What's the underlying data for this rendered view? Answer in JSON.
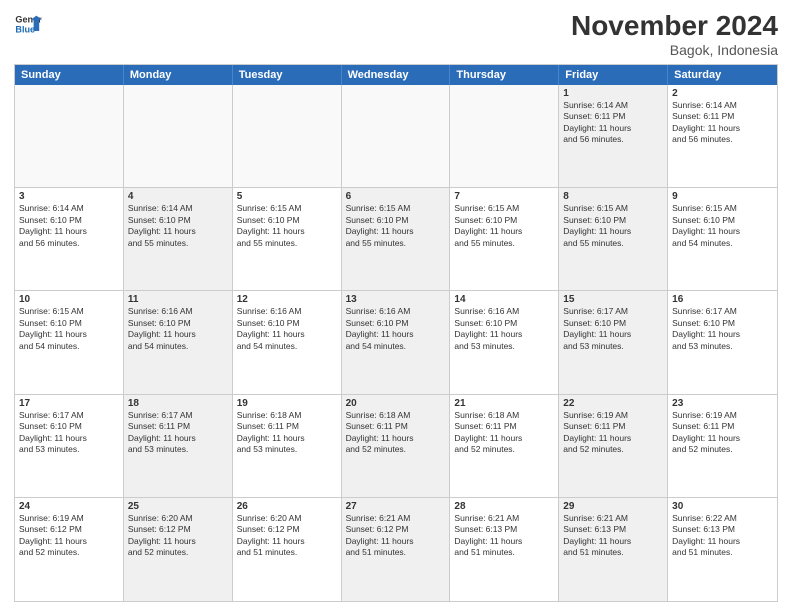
{
  "header": {
    "logo": {
      "line1": "General",
      "line2": "Blue"
    },
    "title": "November 2024",
    "location": "Bagok, Indonesia"
  },
  "dayHeaders": [
    "Sunday",
    "Monday",
    "Tuesday",
    "Wednesday",
    "Thursday",
    "Friday",
    "Saturday"
  ],
  "weeks": [
    [
      {
        "day": "",
        "info": "",
        "empty": true
      },
      {
        "day": "",
        "info": "",
        "empty": true
      },
      {
        "day": "",
        "info": "",
        "empty": true
      },
      {
        "day": "",
        "info": "",
        "empty": true
      },
      {
        "day": "",
        "info": "",
        "empty": true
      },
      {
        "day": "1",
        "info": "Sunrise: 6:14 AM\nSunset: 6:11 PM\nDaylight: 11 hours\nand 56 minutes.",
        "shaded": true
      },
      {
        "day": "2",
        "info": "Sunrise: 6:14 AM\nSunset: 6:11 PM\nDaylight: 11 hours\nand 56 minutes.",
        "shaded": false
      }
    ],
    [
      {
        "day": "3",
        "info": "Sunrise: 6:14 AM\nSunset: 6:10 PM\nDaylight: 11 hours\nand 56 minutes.",
        "shaded": false
      },
      {
        "day": "4",
        "info": "Sunrise: 6:14 AM\nSunset: 6:10 PM\nDaylight: 11 hours\nand 55 minutes.",
        "shaded": true
      },
      {
        "day": "5",
        "info": "Sunrise: 6:15 AM\nSunset: 6:10 PM\nDaylight: 11 hours\nand 55 minutes.",
        "shaded": false
      },
      {
        "day": "6",
        "info": "Sunrise: 6:15 AM\nSunset: 6:10 PM\nDaylight: 11 hours\nand 55 minutes.",
        "shaded": true
      },
      {
        "day": "7",
        "info": "Sunrise: 6:15 AM\nSunset: 6:10 PM\nDaylight: 11 hours\nand 55 minutes.",
        "shaded": false
      },
      {
        "day": "8",
        "info": "Sunrise: 6:15 AM\nSunset: 6:10 PM\nDaylight: 11 hours\nand 55 minutes.",
        "shaded": true
      },
      {
        "day": "9",
        "info": "Sunrise: 6:15 AM\nSunset: 6:10 PM\nDaylight: 11 hours\nand 54 minutes.",
        "shaded": false
      }
    ],
    [
      {
        "day": "10",
        "info": "Sunrise: 6:15 AM\nSunset: 6:10 PM\nDaylight: 11 hours\nand 54 minutes.",
        "shaded": false
      },
      {
        "day": "11",
        "info": "Sunrise: 6:16 AM\nSunset: 6:10 PM\nDaylight: 11 hours\nand 54 minutes.",
        "shaded": true
      },
      {
        "day": "12",
        "info": "Sunrise: 6:16 AM\nSunset: 6:10 PM\nDaylight: 11 hours\nand 54 minutes.",
        "shaded": false
      },
      {
        "day": "13",
        "info": "Sunrise: 6:16 AM\nSunset: 6:10 PM\nDaylight: 11 hours\nand 54 minutes.",
        "shaded": true
      },
      {
        "day": "14",
        "info": "Sunrise: 6:16 AM\nSunset: 6:10 PM\nDaylight: 11 hours\nand 53 minutes.",
        "shaded": false
      },
      {
        "day": "15",
        "info": "Sunrise: 6:17 AM\nSunset: 6:10 PM\nDaylight: 11 hours\nand 53 minutes.",
        "shaded": true
      },
      {
        "day": "16",
        "info": "Sunrise: 6:17 AM\nSunset: 6:10 PM\nDaylight: 11 hours\nand 53 minutes.",
        "shaded": false
      }
    ],
    [
      {
        "day": "17",
        "info": "Sunrise: 6:17 AM\nSunset: 6:10 PM\nDaylight: 11 hours\nand 53 minutes.",
        "shaded": false
      },
      {
        "day": "18",
        "info": "Sunrise: 6:17 AM\nSunset: 6:11 PM\nDaylight: 11 hours\nand 53 minutes.",
        "shaded": true
      },
      {
        "day": "19",
        "info": "Sunrise: 6:18 AM\nSunset: 6:11 PM\nDaylight: 11 hours\nand 53 minutes.",
        "shaded": false
      },
      {
        "day": "20",
        "info": "Sunrise: 6:18 AM\nSunset: 6:11 PM\nDaylight: 11 hours\nand 52 minutes.",
        "shaded": true
      },
      {
        "day": "21",
        "info": "Sunrise: 6:18 AM\nSunset: 6:11 PM\nDaylight: 11 hours\nand 52 minutes.",
        "shaded": false
      },
      {
        "day": "22",
        "info": "Sunrise: 6:19 AM\nSunset: 6:11 PM\nDaylight: 11 hours\nand 52 minutes.",
        "shaded": true
      },
      {
        "day": "23",
        "info": "Sunrise: 6:19 AM\nSunset: 6:11 PM\nDaylight: 11 hours\nand 52 minutes.",
        "shaded": false
      }
    ],
    [
      {
        "day": "24",
        "info": "Sunrise: 6:19 AM\nSunset: 6:12 PM\nDaylight: 11 hours\nand 52 minutes.",
        "shaded": false
      },
      {
        "day": "25",
        "info": "Sunrise: 6:20 AM\nSunset: 6:12 PM\nDaylight: 11 hours\nand 52 minutes.",
        "shaded": true
      },
      {
        "day": "26",
        "info": "Sunrise: 6:20 AM\nSunset: 6:12 PM\nDaylight: 11 hours\nand 51 minutes.",
        "shaded": false
      },
      {
        "day": "27",
        "info": "Sunrise: 6:21 AM\nSunset: 6:12 PM\nDaylight: 11 hours\nand 51 minutes.",
        "shaded": true
      },
      {
        "day": "28",
        "info": "Sunrise: 6:21 AM\nSunset: 6:13 PM\nDaylight: 11 hours\nand 51 minutes.",
        "shaded": false
      },
      {
        "day": "29",
        "info": "Sunrise: 6:21 AM\nSunset: 6:13 PM\nDaylight: 11 hours\nand 51 minutes.",
        "shaded": true
      },
      {
        "day": "30",
        "info": "Sunrise: 6:22 AM\nSunset: 6:13 PM\nDaylight: 11 hours\nand 51 minutes.",
        "shaded": false
      }
    ]
  ]
}
